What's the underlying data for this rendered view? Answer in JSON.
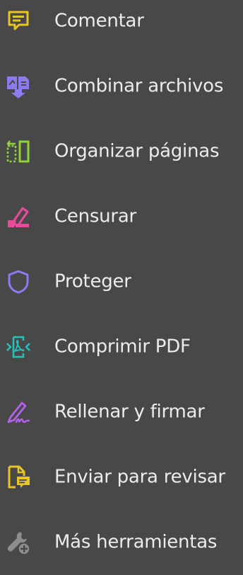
{
  "tools": [
    {
      "label": "Comentar",
      "icon": "comment-icon",
      "color": "#e9c524"
    },
    {
      "label": "Combinar archivos",
      "icon": "combine-files-icon",
      "color": "#8a7cf0"
    },
    {
      "label": "Organizar páginas",
      "icon": "organize-pages-icon",
      "color": "#8fd23a"
    },
    {
      "label": "Censurar",
      "icon": "redact-icon",
      "color": "#ea4a9a"
    },
    {
      "label": "Proteger",
      "icon": "protect-shield-icon",
      "color": "#8a7cf0"
    },
    {
      "label": "Comprimir PDF",
      "icon": "compress-pdf-icon",
      "color": "#22c3bd"
    },
    {
      "label": "Rellenar y firmar",
      "icon": "fill-sign-icon",
      "color": "#b062e8"
    },
    {
      "label": "Enviar para revisar",
      "icon": "send-for-review-icon",
      "color": "#e9c524"
    },
    {
      "label": "Más herramientas",
      "icon": "more-tools-icon",
      "color": "#8d8d8d"
    }
  ]
}
